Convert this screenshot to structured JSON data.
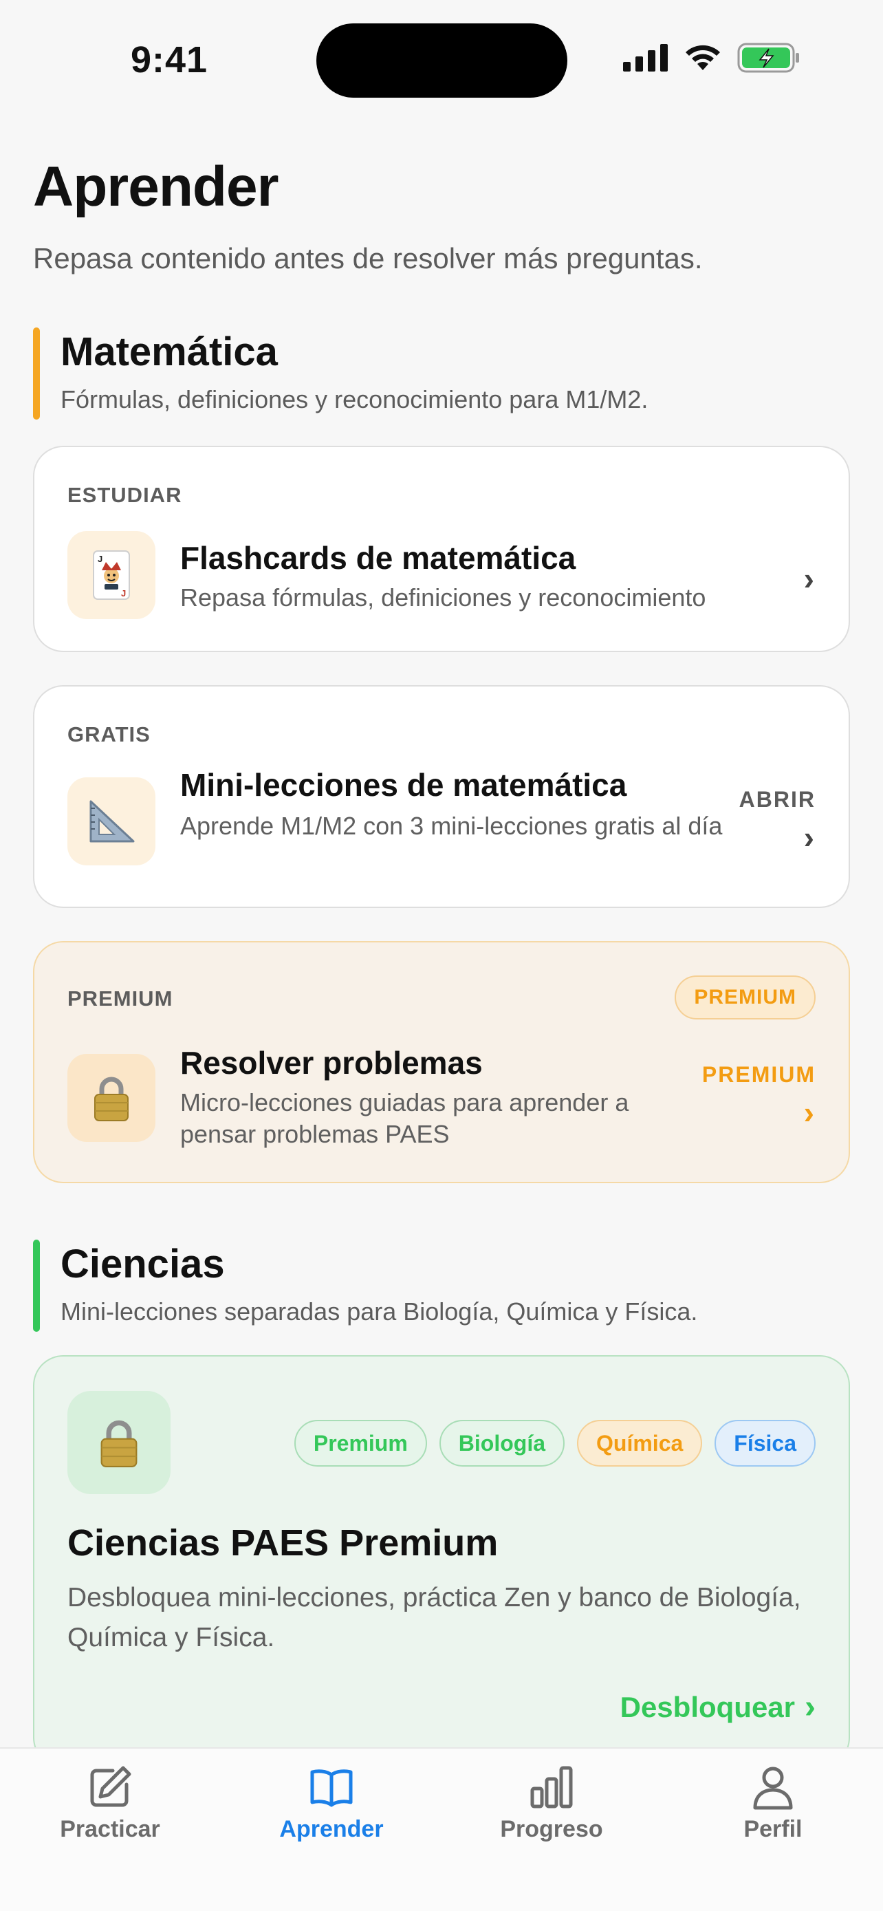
{
  "status_bar": {
    "time": "9:41"
  },
  "header": {
    "title": "Aprender",
    "subtitle": "Repasa contenido antes de resolver más preguntas."
  },
  "sections": {
    "math": {
      "title": "Matemática",
      "subtitle": "Fórmulas, definiciones y reconocimiento para M1/M2.",
      "accent": "#f5a623",
      "cards": [
        {
          "kicker": "ESTUDIAR",
          "title": "Flashcards de matemática",
          "desc": "Repasa fórmulas, definiciones y reconocimiento",
          "icon": "joker-card-icon"
        },
        {
          "kicker": "GRATIS",
          "title": "Mini-lecciones de matemática",
          "desc": "Aprende M1/M2 con 3 mini-lecciones gratis al día",
          "action": "ABRIR",
          "icon": "triangle-ruler-icon"
        },
        {
          "kicker": "PREMIUM",
          "badge": "PREMIUM",
          "title": "Resolver problemas",
          "desc": "Micro-lecciones guiadas para aprender a pensar problemas PAES",
          "action": "PREMIUM",
          "icon": "lock-icon"
        }
      ]
    },
    "science": {
      "title": "Ciencias",
      "subtitle": "Mini-lecciones separadas para Biología, Química y Física.",
      "accent": "#34c759",
      "card": {
        "tags": [
          "Premium",
          "Biología",
          "Química",
          "Física"
        ],
        "title": "Ciencias PAES Premium",
        "desc": "Desbloquea mini-lecciones, práctica Zen y banco de Biología, Química y Física.",
        "cta": "Desbloquear",
        "icon": "lock-icon"
      }
    }
  },
  "tab_bar": {
    "active": "Aprender",
    "active_color": "#1a7fe8",
    "items": [
      {
        "label": "Practicar",
        "icon": "pencil-square-icon"
      },
      {
        "label": "Aprender",
        "icon": "open-book-icon"
      },
      {
        "label": "Progreso",
        "icon": "bar-chart-icon"
      },
      {
        "label": "Perfil",
        "icon": "person-icon"
      }
    ]
  }
}
